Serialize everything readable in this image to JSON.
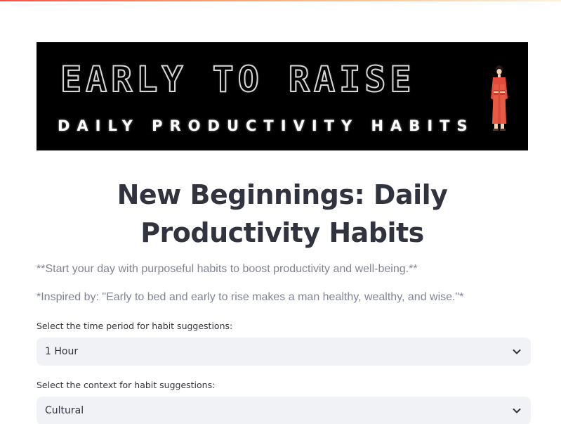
{
  "banner": {
    "title": "EARLY TO RAISE",
    "subtitle": "DAILY PRODUCTIVITY HABITS"
  },
  "page": {
    "title": "New Beginnings: Daily Productivity Habits",
    "intro_line": "**Start your day with purposeful habits to boost productivity and well-being.**",
    "quote_line": "*Inspired by: \"Early to bed and early to rise makes a man healthy, wealthy, and wise.\"*"
  },
  "time_period": {
    "label": "Select the time period for habit suggestions:",
    "selected": "1 Hour",
    "icon": "chevron-down-icon"
  },
  "context": {
    "label": "Select the context for habit suggestions:",
    "selected": "Cultural",
    "icon": "chevron-down-icon"
  },
  "colors": {
    "text": "#31333f",
    "muted_text": "#808495",
    "select_bg": "#f0f2f6",
    "accent": "#ff4b4b"
  }
}
